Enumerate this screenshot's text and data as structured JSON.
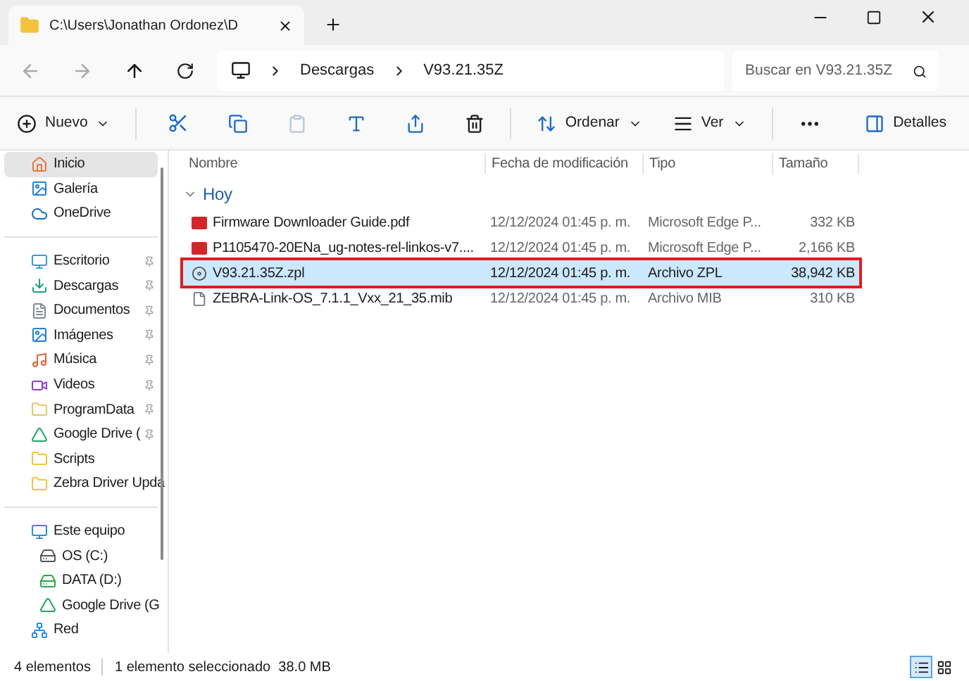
{
  "window": {
    "tab_title": "C:\\Users\\Jonathan Ordonez\\D"
  },
  "address": {
    "crumbs": [
      "Descargas",
      "V93.21.35Z"
    ]
  },
  "search": {
    "placeholder": "Buscar en V93.21.35Z"
  },
  "toolbar": {
    "new": "Nuevo",
    "sort": "Ordenar",
    "view": "Ver",
    "details": "Detalles"
  },
  "sidebar": {
    "groups": [
      [
        {
          "label": "Inicio",
          "selected": true
        },
        {
          "label": "Galería",
          "selected": false
        },
        {
          "label": "OneDrive",
          "selected": false
        }
      ],
      [
        {
          "label": "Escritorio",
          "selected": false,
          "pinned": true
        },
        {
          "label": "Descargas",
          "selected": false,
          "pinned": true
        },
        {
          "label": "Documentos",
          "selected": false,
          "pinned": true
        },
        {
          "label": "Imágenes",
          "selected": false,
          "pinned": true
        },
        {
          "label": "Música",
          "selected": false,
          "pinned": true
        },
        {
          "label": "Videos",
          "selected": false,
          "pinned": true
        },
        {
          "label": "ProgramData",
          "selected": false,
          "pinned": true
        },
        {
          "label": "Google Drive (",
          "selected": false,
          "pinned": true
        },
        {
          "label": "Scripts",
          "selected": false,
          "pinned": false
        },
        {
          "label": "Zebra Driver Upda",
          "selected": false,
          "pinned": false
        }
      ],
      [
        {
          "label": "Este equipo",
          "selected": false,
          "children": [
            {
              "label": "OS (C:)",
              "selected": false
            },
            {
              "label": "DATA (D:)",
              "selected": false
            },
            {
              "label": "Google Drive (G",
              "selected": false
            }
          ]
        },
        {
          "label": "Red",
          "selected": false
        }
      ]
    ]
  },
  "table": {
    "columns": [
      "Nombre",
      "Fecha de modificación",
      "Tipo",
      "Tamaño"
    ],
    "group": "Hoy",
    "rows": [
      {
        "kind": "pdf",
        "name": "Firmware Downloader Guide.pdf",
        "date": "12/12/2024 01:45 p. m.",
        "type": "Microsoft Edge P...",
        "size": "332 KB",
        "selected": false,
        "highlighted": false
      },
      {
        "kind": "pdf",
        "name": "P1105470-20ENa_ug-notes-rel-linkos-v7....",
        "date": "12/12/2024 01:45 p. m.",
        "type": "Microsoft Edge P...",
        "size": "2,166 KB",
        "selected": false,
        "highlighted": false
      },
      {
        "kind": "zpl",
        "name": "V93.21.35Z.zpl",
        "date": "12/12/2024 01:45 p. m.",
        "type": "Archivo ZPL",
        "size": "38,942 KB",
        "selected": true,
        "highlighted": true
      },
      {
        "kind": "file",
        "name": "ZEBRA-Link-OS_7.1.1_Vxx_21_35.mib",
        "date": "12/12/2024 01:45 p. m.",
        "type": "Archivo MIB",
        "size": "310 KB",
        "selected": false,
        "highlighted": false
      }
    ]
  },
  "status_bar": {
    "count": "4 elementos",
    "selection": "1 elemento seleccionado  38.0 MB"
  },
  "view_buttons": [
    {
      "kind": "details",
      "selected": true
    },
    {
      "kind": "tiles",
      "selected": false
    }
  ]
}
